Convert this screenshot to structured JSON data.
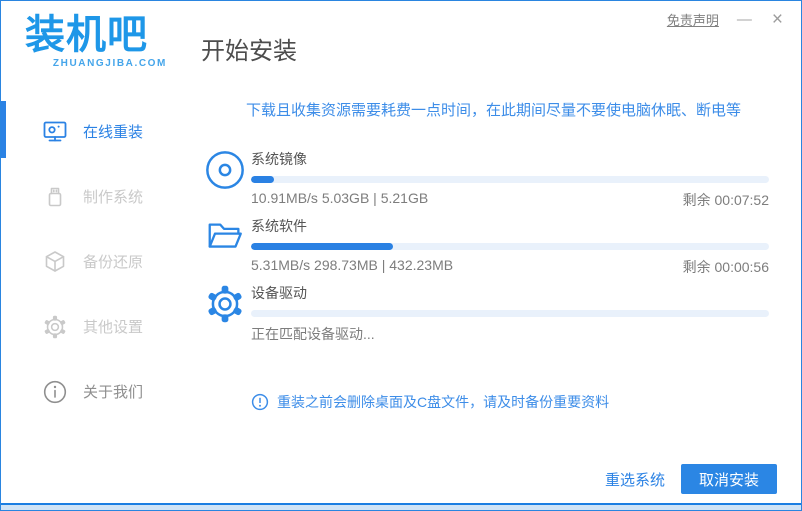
{
  "window": {
    "logo": {
      "title": "装机吧",
      "subtitle": "ZHUANGJIBA.COM"
    },
    "titlebar": {
      "disclaimer": "免责声明",
      "minimize": "—",
      "close": "×"
    },
    "page_title": "开始安装"
  },
  "sidebar": {
    "items": [
      {
        "key": "online-reinstall",
        "label": "在线重装",
        "icon": "monitor-icon",
        "active": true
      },
      {
        "key": "make-system",
        "label": "制作系统",
        "icon": "usb-icon",
        "active": false
      },
      {
        "key": "backup-restore",
        "label": "备份还原",
        "icon": "backup-icon",
        "active": false
      },
      {
        "key": "other-settings",
        "label": "其他设置",
        "icon": "gear-icon",
        "active": false
      },
      {
        "key": "about-us",
        "label": "关于我们",
        "icon": "info-icon",
        "active": false
      }
    ]
  },
  "main": {
    "notice": "下载且收集资源需要耗费一点时间，在此期间尽量不要使电脑休眠、断电等",
    "tasks": [
      {
        "key": "system-image",
        "name": "系统镜像",
        "icon": "disc-icon",
        "progress_percent": 4.5,
        "stats": "10.91MB/s 5.03GB | 5.21GB",
        "remaining": "剩余 00:07:52"
      },
      {
        "key": "system-software",
        "name": "系统软件",
        "icon": "folder-icon",
        "progress_percent": 27.5,
        "stats": "5.31MB/s 298.73MB | 432.23MB",
        "remaining": "剩余 00:00:56"
      },
      {
        "key": "device-driver",
        "name": "设备驱动",
        "icon": "gear-icon",
        "progress_percent": 0,
        "stats": "正在匹配设备驱动...",
        "remaining": ""
      }
    ],
    "warning": "重装之前会删除桌面及C盘文件，请及时备份重要资料",
    "buttons": {
      "reselect": "重选系统",
      "cancel": "取消安装"
    }
  },
  "colors": {
    "primary": "#2b86e4",
    "logo_blue": "#1e97e8",
    "notice_text": "#3d8de8",
    "progress_track": "#e9f1fb",
    "progress_fill": "#2a81e3",
    "inactive_sidebar": "#c9c9c9"
  }
}
